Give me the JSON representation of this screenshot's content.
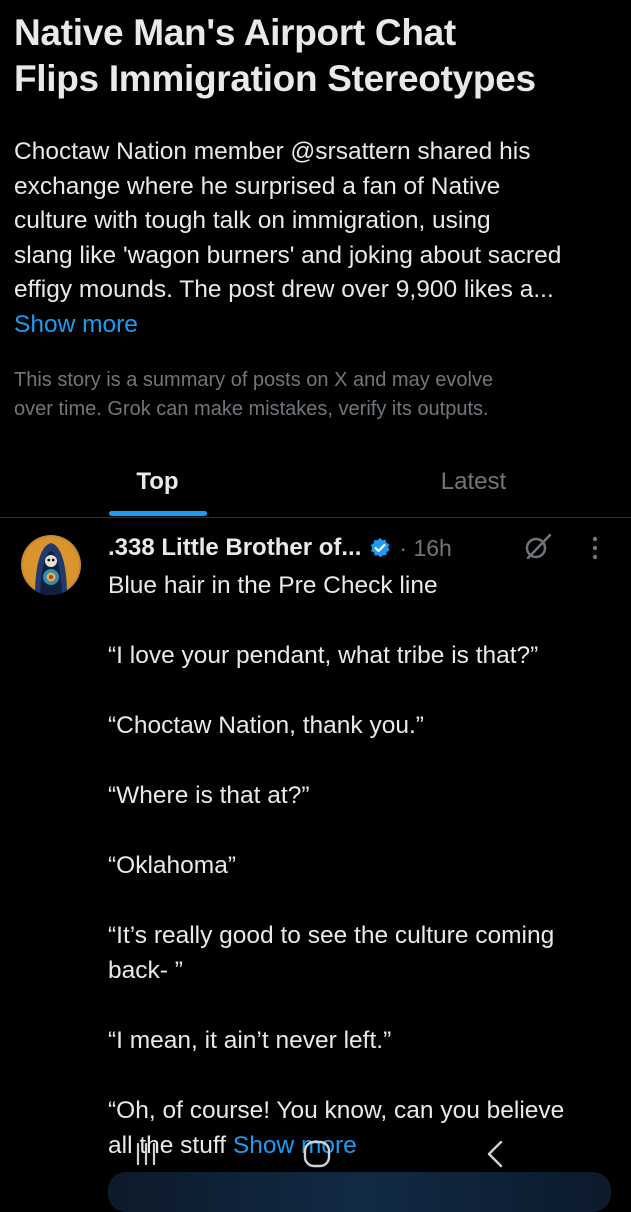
{
  "story": {
    "title_lines": [
      "Native Man's Airport Chat",
      "Flips Immigration Stereotypes"
    ],
    "summary_lines": [
      "Choctaw Nation member @srsattern shared his",
      "exchange where he surprised a fan of Native",
      "culture with tough talk on immigration, using",
      "slang like 'wagon burners' and joking about sacred",
      "effigy mounds. The post drew over 9,900 likes a..."
    ],
    "show_more": "Show more",
    "disclaimer_lines": [
      "This story is a summary of posts on X and may evolve",
      "over time. Grok can make mistakes, verify its outputs."
    ]
  },
  "tabs": [
    {
      "label": "Top",
      "active": true
    },
    {
      "label": "Latest",
      "active": false
    }
  ],
  "post": {
    "author": ".338 Little Brother of...",
    "separator": "·",
    "time": "16h",
    "lines": [
      "Blue hair in the Pre Check line",
      "“I love your pendant, what tribe is that?”",
      "“Choctaw Nation, thank you.”",
      "“Where is that at?”",
      "“Oklahoma”",
      "“It’s really good to see the culture coming",
      "back- ”",
      "“I mean, it ain’t never left.”",
      "“Oh, of course! You know, can you believe",
      "all the stuff"
    ],
    "show_more": "Show more"
  },
  "icons": {
    "verified": "verified-badge-icon",
    "grok": "grok-icon",
    "more": "more-options-icon",
    "nav_recents": "recent-apps-icon",
    "nav_home": "home-icon",
    "nav_back": "back-icon"
  },
  "colors": {
    "background": "#000000",
    "text": "#e7e9ea",
    "muted": "#71767b",
    "accent": "#1d9bf0"
  }
}
